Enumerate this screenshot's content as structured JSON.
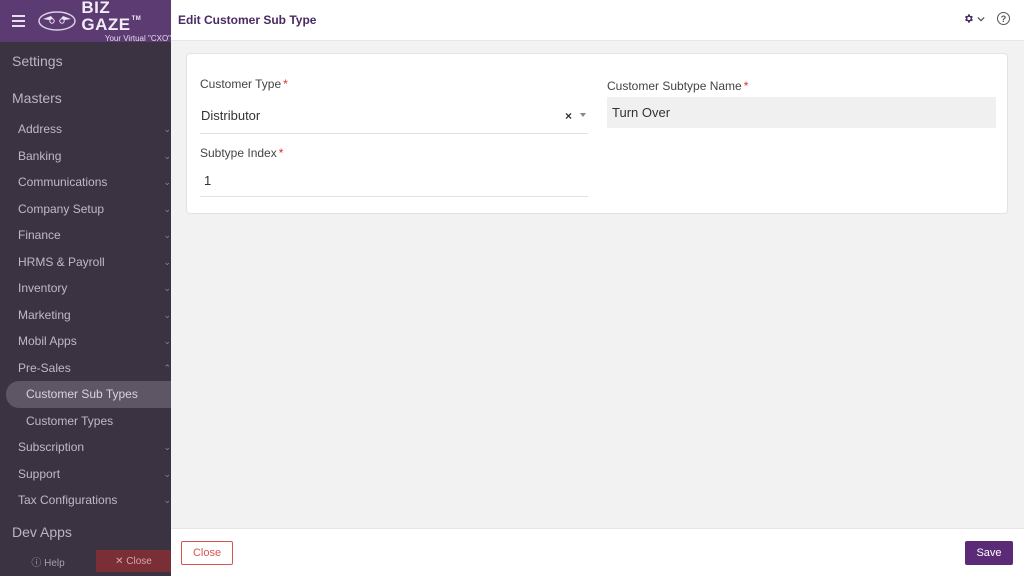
{
  "brand": {
    "name": "BIZ GAZE",
    "tm": "TM",
    "tagline": "Your Virtual \"CXO\""
  },
  "sidebar": {
    "sections": {
      "settings": "Settings",
      "masters": "Masters",
      "dev_apps": "Dev Apps"
    },
    "items": [
      "Address",
      "Banking",
      "Communications",
      "Company Setup",
      "Finance",
      "HRMS & Payroll",
      "Inventory",
      "Marketing",
      "Mobil Apps",
      "Pre-Sales"
    ],
    "sub_items": [
      "Customer Sub Types",
      "Customer Types"
    ],
    "items_after": [
      "Subscription",
      "Support",
      "Tax Configurations"
    ],
    "help_label": "Help",
    "close_label": "Close"
  },
  "header": {
    "title": "Edit Customer Sub Type"
  },
  "form": {
    "customer_type": {
      "label": "Customer Type",
      "value": "Distributor",
      "required": "*"
    },
    "subtype_name": {
      "label": "Customer Subtype Name",
      "value": "Turn Over",
      "required": "*"
    },
    "subtype_index": {
      "label": "Subtype Index",
      "value": "1",
      "required": "*"
    }
  },
  "footer": {
    "close_label": "Close",
    "save_label": "Save"
  },
  "colors": {
    "accent": "#5b2b78",
    "danger": "#d9534f",
    "sidebar": "#3b3342"
  }
}
